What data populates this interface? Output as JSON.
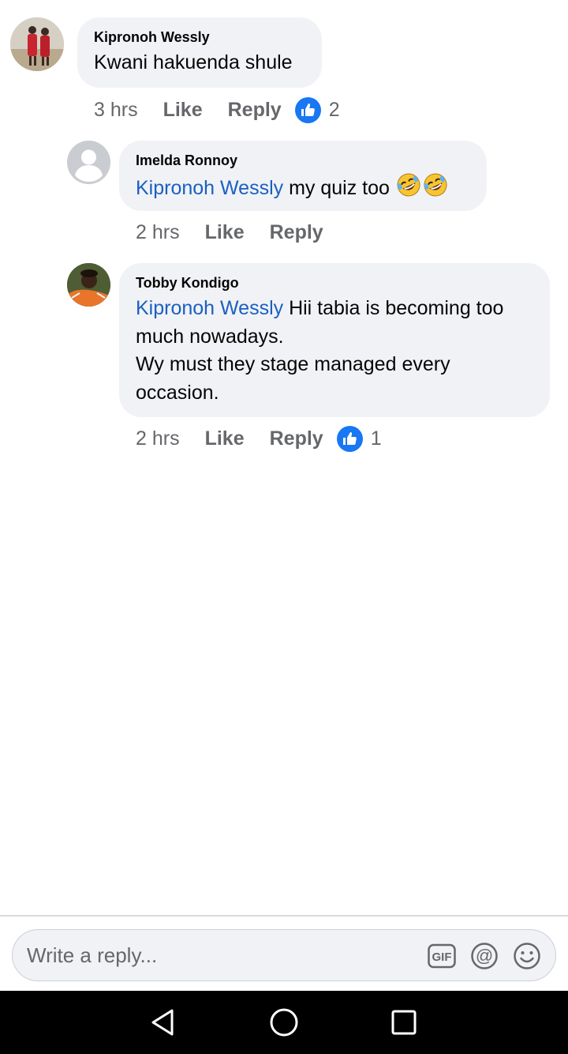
{
  "comments": [
    {
      "author": "Kipronoh Wessly",
      "mention": "",
      "lines": [
        "Kwani hakuenda shule"
      ],
      "time": "3 hrs",
      "like_label": "Like",
      "reply_label": "Reply",
      "like_count": "2"
    },
    {
      "author": "Imelda Ronnoy",
      "mention": "Kipronoh Wessly",
      "text": " my quiz too ",
      "emojis": [
        "rofl-emoji",
        "rofl-emoji"
      ],
      "time": "2 hrs",
      "like_label": "Like",
      "reply_label": "Reply"
    },
    {
      "author": "Tobby Kondigo",
      "mention": "Kipronoh Wessly",
      "line1_rest": " Hii tabia is becoming too",
      "line2": "much nowadays.",
      "line3": "Wy must they stage managed every",
      "line4": "occasion.",
      "time": "2 hrs",
      "like_label": "Like",
      "reply_label": "Reply",
      "like_count": "1"
    }
  ],
  "reply_box": {
    "placeholder": "Write a reply...",
    "icons": [
      "gif-icon",
      "mention-at-icon",
      "smiley-icon"
    ]
  },
  "navigation": {
    "icons": [
      "back-triangle-icon",
      "home-circle-icon",
      "recents-square-icon"
    ]
  },
  "colors": {
    "bubble": "#f0f2f5",
    "mention": "#1b5fc2",
    "like_blue": "#1877f2",
    "meta_gray": "#65676b",
    "nav_bg": "#000000"
  }
}
